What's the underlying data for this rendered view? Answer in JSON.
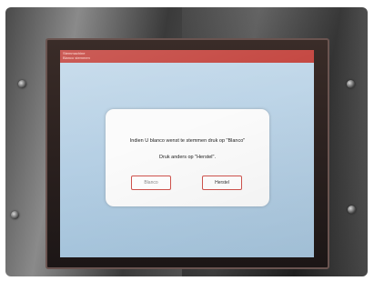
{
  "window": {
    "title": "Stemmachine",
    "subtitle": "Blanco stemmen"
  },
  "dialog": {
    "message": "Indien U blanco wenst te stemmen druk op \"Blanco\"",
    "hint": "Druk anders op \"Herstel\".",
    "blanco_label": "Blanco",
    "herstel_label": "Herstel"
  },
  "colors": {
    "title_bar": "#c44640",
    "screen_background": "#b5cfe4",
    "button_border": "#d0534d"
  }
}
